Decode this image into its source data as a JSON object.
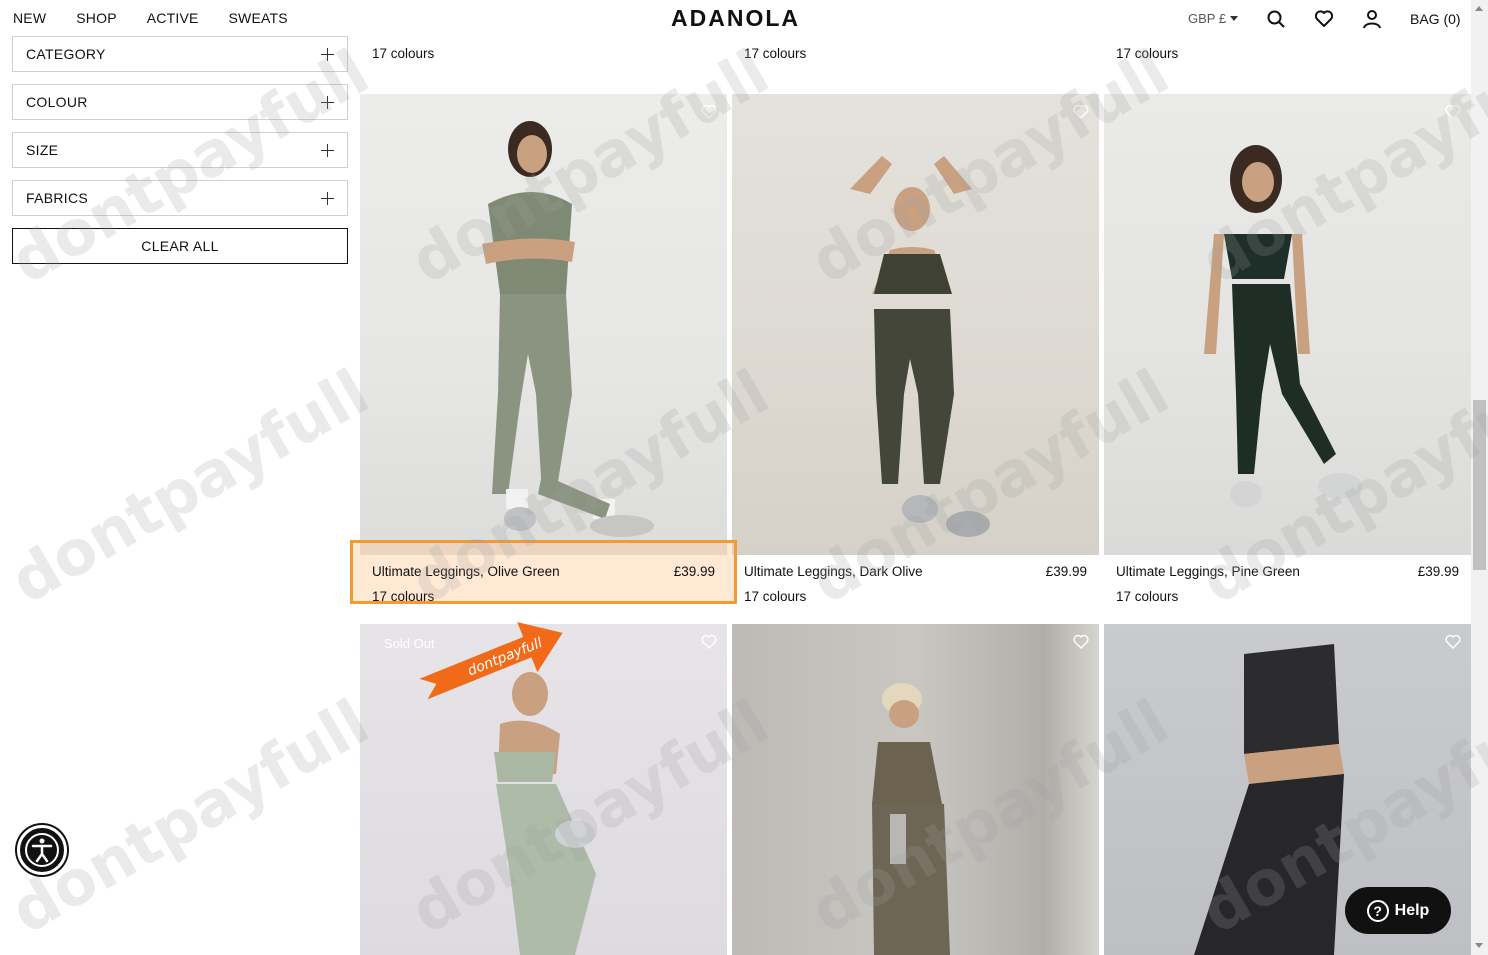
{
  "header": {
    "nav": [
      "NEW",
      "SHOP",
      "ACTIVE",
      "SWEATS"
    ],
    "logo": "ADANOLA",
    "currency": "GBP £",
    "bag": "BAG (0)"
  },
  "filters": {
    "items": [
      "CATEGORY",
      "COLOUR",
      "SIZE",
      "FABRICS"
    ],
    "clear_all": "CLEAR ALL"
  },
  "products": {
    "top_row_colours": [
      "17 colours",
      "17 colours",
      "17 colours"
    ],
    "row2": [
      {
        "name": "Ultimate Leggings, Olive Green",
        "price": "£39.99",
        "colours": "17 colours"
      },
      {
        "name": "Ultimate Leggings, Dark Olive",
        "price": "£39.99",
        "colours": "17 colours"
      },
      {
        "name": "Ultimate Leggings, Pine Green",
        "price": "£39.99",
        "colours": "17 colours"
      }
    ],
    "sold_out": "Sold Out"
  },
  "watermark": "dontpayfull",
  "help": {
    "label": "Help",
    "glyph": "?"
  }
}
